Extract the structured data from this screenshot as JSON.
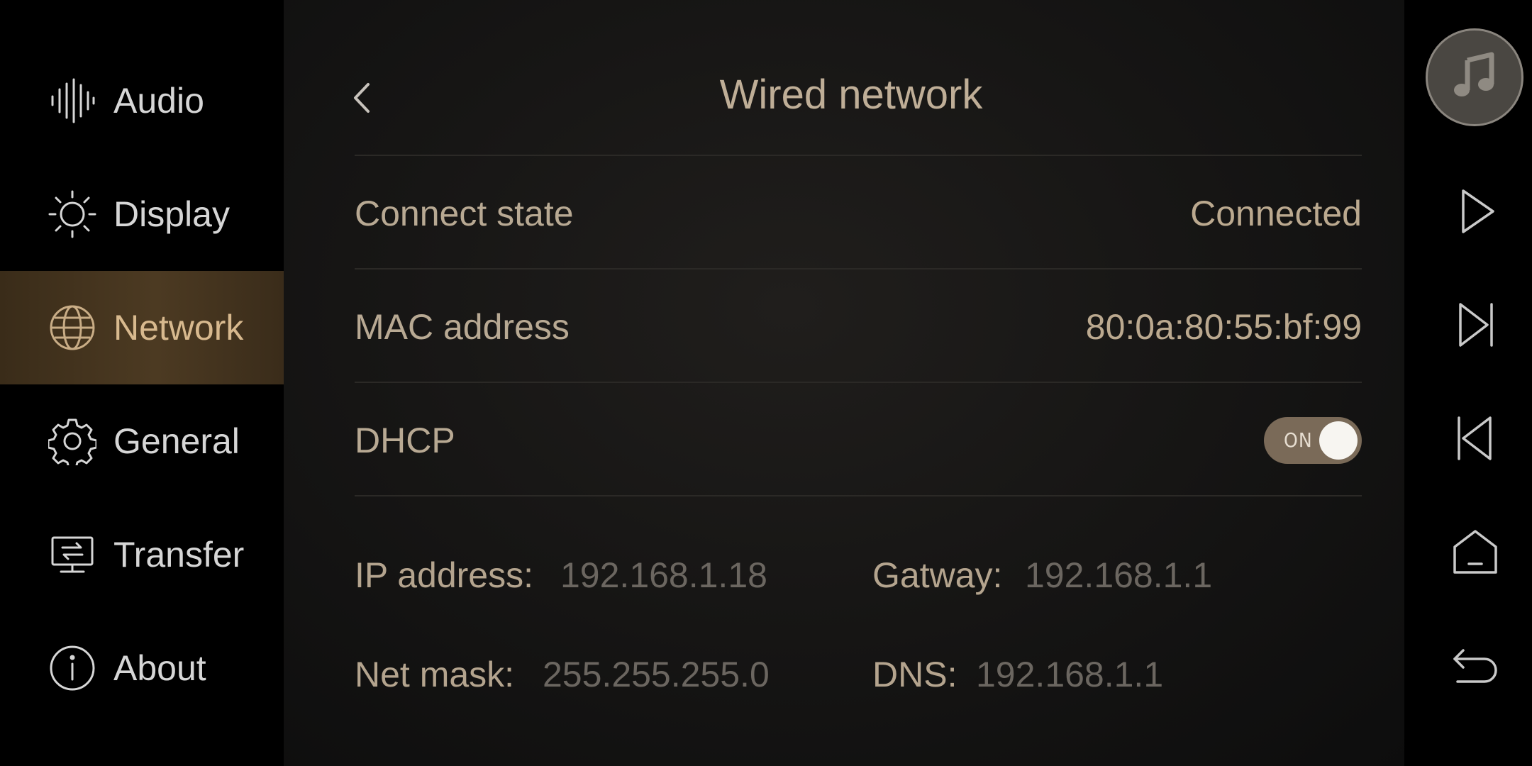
{
  "sidebar": {
    "items": [
      {
        "label": "Audio",
        "icon": "audio-waveform-icon"
      },
      {
        "label": "Display",
        "icon": "sun-icon"
      },
      {
        "label": "Network",
        "icon": "globe-icon",
        "active": true
      },
      {
        "label": "General",
        "icon": "gear-icon"
      },
      {
        "label": "Transfer",
        "icon": "transfer-monitor-icon"
      },
      {
        "label": "About",
        "icon": "info-icon"
      }
    ]
  },
  "header": {
    "title": "Wired network",
    "back_icon": "chevron-left-icon"
  },
  "settings": {
    "connect_state": {
      "label": "Connect state",
      "value": "Connected"
    },
    "mac_address": {
      "label": "MAC address",
      "value": "80:0a:80:55:bf:99"
    },
    "dhcp": {
      "label": "DHCP",
      "toggle_text": "ON",
      "on": true
    }
  },
  "network_info": {
    "ip": {
      "label": "IP address:",
      "value": "192.168.1.18"
    },
    "gateway": {
      "label": "Gatway:",
      "value": "192.168.1.1"
    },
    "netmask": {
      "label": "Net mask:",
      "value": "255.255.255.0"
    },
    "dns": {
      "label": "DNS:",
      "value": "192.168.1.1"
    }
  },
  "controls": [
    "music-note-icon",
    "play-icon",
    "next-track-icon",
    "previous-track-icon",
    "home-icon",
    "back-return-icon"
  ],
  "colors": {
    "accent": "#d8b98e",
    "active_bg": "#4c3a22",
    "toggle_bg": "#7a6a58"
  }
}
